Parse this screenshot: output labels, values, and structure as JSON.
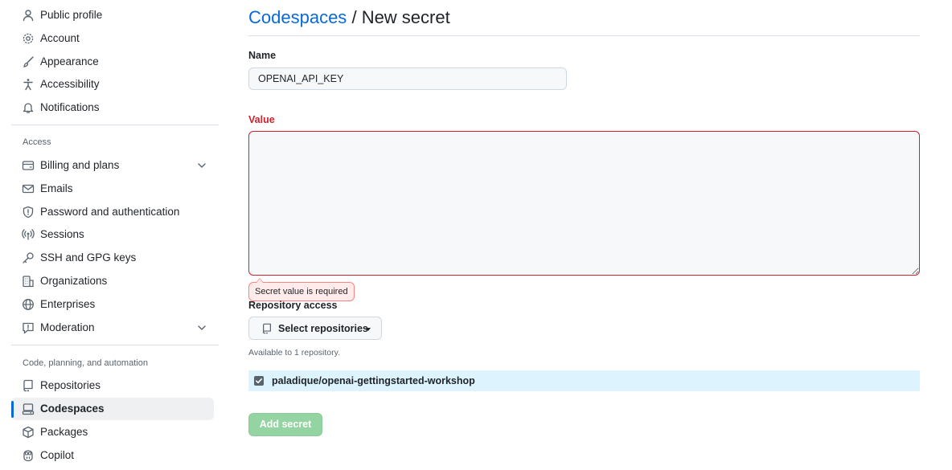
{
  "sidebar": {
    "items": [
      {
        "label": "Public profile",
        "icon": "person-icon"
      },
      {
        "label": "Account",
        "icon": "gear-icon"
      },
      {
        "label": "Appearance",
        "icon": "paintbrush-icon"
      },
      {
        "label": "Accessibility",
        "icon": "accessibility-icon"
      },
      {
        "label": "Notifications",
        "icon": "bell-icon"
      }
    ],
    "access_heading": "Access",
    "access_items": [
      {
        "label": "Billing and plans",
        "icon": "credit-card-icon"
      },
      {
        "label": "Emails",
        "icon": "mail-icon"
      },
      {
        "label": "Password and authentication",
        "icon": "shield-icon"
      },
      {
        "label": "Sessions",
        "icon": "broadcast-icon"
      },
      {
        "label": "SSH and GPG keys",
        "icon": "key-icon"
      },
      {
        "label": "Organizations",
        "icon": "organization-icon"
      },
      {
        "label": "Enterprises",
        "icon": "globe-icon"
      },
      {
        "label": "Moderation",
        "icon": "report-icon"
      }
    ],
    "code_heading": "Code, planning, and automation",
    "code_items": [
      {
        "label": "Repositories",
        "icon": "repo-icon"
      },
      {
        "label": "Codespaces",
        "icon": "codespaces-icon",
        "active": true
      },
      {
        "label": "Packages",
        "icon": "package-icon"
      },
      {
        "label": "Copilot",
        "icon": "copilot-icon"
      }
    ]
  },
  "header": {
    "breadcrumb_link": "Codespaces",
    "separator": "/",
    "current": "New secret"
  },
  "form": {
    "name_label": "Name",
    "name_value": "OPENAI_API_KEY",
    "value_label": "Value",
    "value_text": "",
    "value_error": "Secret value is required",
    "repo_access_label": "Repository access",
    "select_button_label": "Select repositories",
    "availability_note": "Available to 1 repository.",
    "selected_repository": "paladique/openai-gettingstarted-workshop",
    "repository_checked": true,
    "submit_label": "Add secret",
    "submit_disabled": true
  },
  "colors": {
    "link": "#0969da",
    "error": "#cf222e",
    "active_indicator": "#0969da",
    "repo_row_bg": "#ddf4ff",
    "disabled_primary": "#94d3a2"
  }
}
